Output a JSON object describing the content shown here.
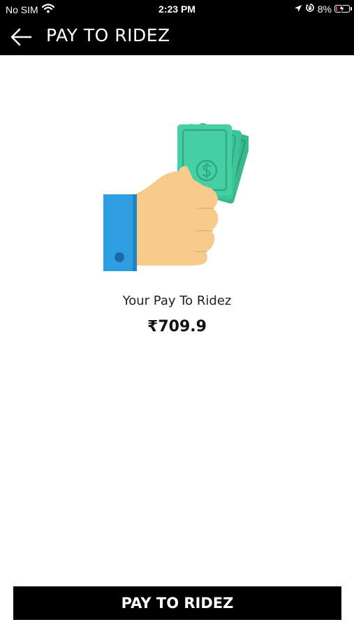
{
  "status_bar": {
    "carrier": "No SIM",
    "time": "2:23 PM",
    "battery_percent": "8%",
    "battery_level": 0.08,
    "battery_color": "#e53935",
    "icons": [
      "wifi-icon",
      "location-arrow-icon",
      "orientation-lock-icon",
      "battery-icon",
      "charging-bolt-icon"
    ]
  },
  "header": {
    "title": "PAY TO RIDEZ",
    "back_icon": "arrow-left-icon"
  },
  "main": {
    "illustration": "hand-holding-cash",
    "caption": "Your Pay To Ridez",
    "amount": "₹709.9"
  },
  "footer": {
    "button_label": "PAY TO RIDEZ"
  },
  "colors": {
    "header_background": "#000000",
    "button_background": "#000000",
    "page_background": "#ffffff",
    "cash_green": "#3ec49a",
    "sleeve_blue": "#2e9ee0",
    "skin": "#f6cb8c"
  }
}
